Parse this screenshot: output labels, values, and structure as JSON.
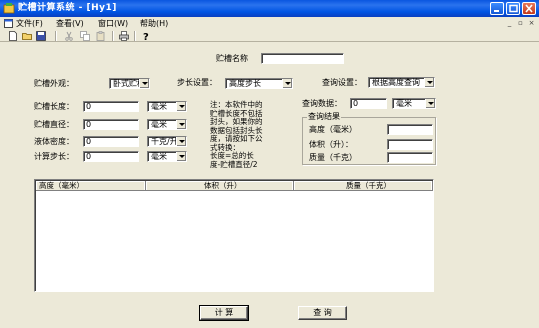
{
  "window": {
    "title": "贮槽计算系统 - [Hy1]"
  },
  "menu": {
    "items": [
      "文件(F)",
      "查看(V)",
      "窗口(W)",
      "帮助(H)"
    ]
  },
  "form": {
    "tank_name_label": "贮槽名称",
    "tank_name_value": "",
    "shape_label": "贮槽外观：",
    "shape_value": "卧式贮槽",
    "step_label": "步长设置：",
    "step_value": "高度步长",
    "query_setting_label": "查询设置：",
    "query_setting_value": "根据高度查询",
    "length_label": "贮槽长度：",
    "length_value": "0",
    "length_unit": "毫米",
    "diameter_label": "贮槽直径：",
    "diameter_value": "0",
    "diameter_unit": "毫米",
    "density_label": "液体密度：",
    "density_value": "0",
    "density_unit": "千克/升",
    "calc_step_label": "计算步长：",
    "calc_step_value": "0",
    "calc_step_unit": "毫米",
    "note_text": "注：本软件中的\n贮槽长度不包括\n封头，如果你的\n数据包括封头长\n度，请按如下公\n式转换：\n  长度=总的长\n度-贮槽直径/2",
    "query_data_label": "查询数据：",
    "query_data_value": "0",
    "query_data_unit": "毫米"
  },
  "results": {
    "legend": "查询结果",
    "height_label": "高度（毫米）",
    "height_value": "",
    "volume_label": "体积（升）：",
    "volume_value": "",
    "mass_label": "质量（千克）",
    "mass_value": ""
  },
  "table": {
    "columns": [
      "高度（毫米）",
      "体积（升）",
      "质量（千克）"
    ],
    "rows": []
  },
  "buttons": {
    "calculate": "计 算",
    "query": "查 询"
  }
}
